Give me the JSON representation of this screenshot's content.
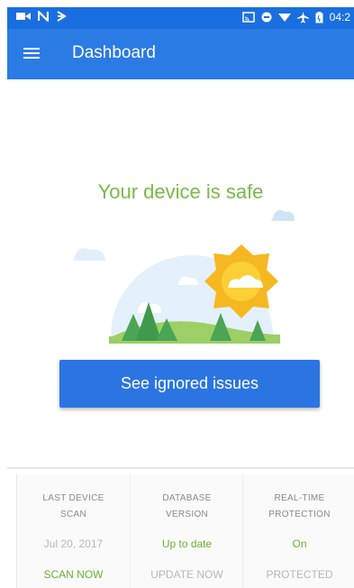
{
  "status_bar": {
    "time": "04:2"
  },
  "app_bar": {
    "title": "Dashboard"
  },
  "main": {
    "status_text": "Your device is safe",
    "ignored_button_label": "See ignored issues"
  },
  "bottom_panel": {
    "columns": [
      {
        "label_line1": "LAST DEVICE",
        "label_line2": "SCAN",
        "value": "Jul 20, 2017",
        "action": "SCAN NOW"
      },
      {
        "label_line1": "DATABASE",
        "label_line2": "VERSION",
        "value": "Up to date",
        "action": "UPDATE NOW"
      },
      {
        "label_line1": "REAL-TIME",
        "label_line2": "PROTECTION",
        "value": "On",
        "action": "PROTECTED"
      }
    ]
  },
  "colors": {
    "accent_blue": "#2a7be4",
    "safe_green": "#7ab84a",
    "action_green": "#6ab22f",
    "muted_gray": "#b8b8b8"
  }
}
